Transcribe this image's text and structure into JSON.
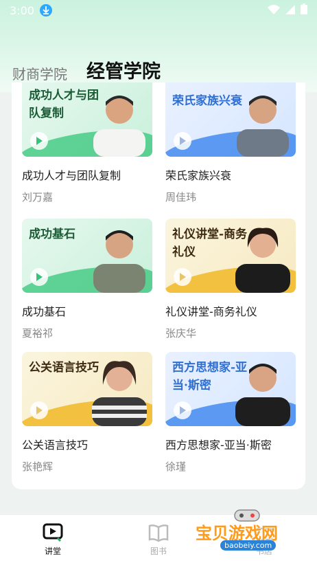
{
  "status": {
    "time": "3:00"
  },
  "tabs": {
    "inactive": "财商学院",
    "active": "经管学院"
  },
  "courses": [
    {
      "thumb_title": "成功人才与团队复制",
      "title": "成功人才与团队复制",
      "author": "刘万嘉",
      "theme": "green"
    },
    {
      "thumb_title": "荣氏家族兴衰",
      "title": "荣氏家族兴衰",
      "author": "周佳玮",
      "theme": "blue"
    },
    {
      "thumb_title": "成功基石",
      "title": "成功基石",
      "author": "夏裕祁",
      "theme": "green"
    },
    {
      "thumb_title": "礼仪讲堂-商务礼仪",
      "title": "礼仪讲堂-商务礼仪",
      "author": "张庆华",
      "theme": "yellow"
    },
    {
      "thumb_title": "公关语言技巧",
      "title": "公关语言技巧",
      "author": "张艳辉",
      "theme": "yellow"
    },
    {
      "thumb_title": "西方思想家-亚当·斯密",
      "title": "西方思想家-亚当·斯密",
      "author": "徐瑾",
      "theme": "blue"
    }
  ],
  "bottom_nav": {
    "item1": "讲堂",
    "item2": "图书",
    "item3": "书店"
  },
  "watermark": {
    "text": "宝贝游戏网",
    "url": "baobeiy.com"
  },
  "colors": {
    "accent": "#2fae66",
    "header_bg": "#cbf2df"
  }
}
